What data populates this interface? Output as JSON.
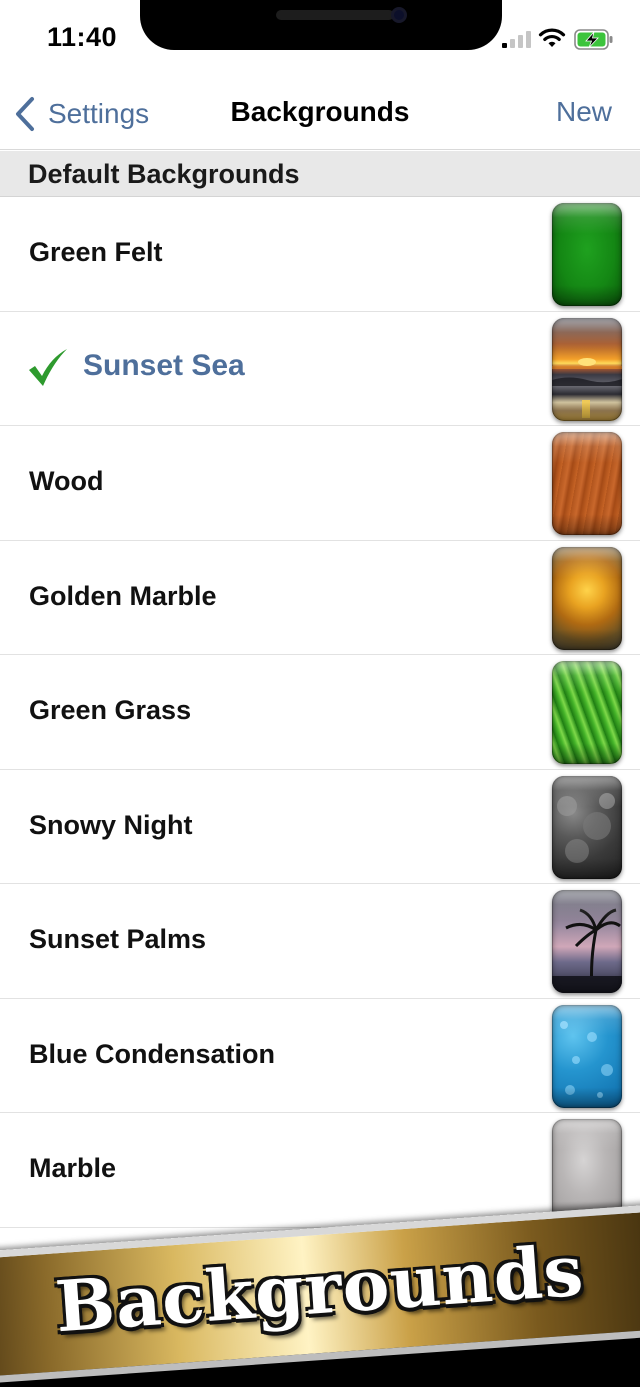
{
  "status_bar": {
    "time": "11:40"
  },
  "nav": {
    "back_label": "Settings",
    "title": "Backgrounds",
    "new_label": "New"
  },
  "section": {
    "title": "Default Backgrounds"
  },
  "backgrounds": [
    {
      "label": "Green Felt",
      "selected": false,
      "thumb": "green-felt-thumbnail"
    },
    {
      "label": "Sunset Sea",
      "selected": true,
      "thumb": "sunset-sea-thumbnail"
    },
    {
      "label": "Wood",
      "selected": false,
      "thumb": "wood-thumbnail"
    },
    {
      "label": "Golden Marble",
      "selected": false,
      "thumb": "golden-marble-thumbnail"
    },
    {
      "label": "Green Grass",
      "selected": false,
      "thumb": "green-grass-thumbnail"
    },
    {
      "label": "Snowy Night",
      "selected": false,
      "thumb": "snowy-night-thumbnail"
    },
    {
      "label": "Sunset Palms",
      "selected": false,
      "thumb": "sunset-palms-thumbnail"
    },
    {
      "label": "Blue Condensation",
      "selected": false,
      "thumb": "blue-condensation-thumbnail"
    },
    {
      "label": "Marble",
      "selected": false,
      "thumb": "marble-thumbnail"
    }
  ],
  "banner": {
    "text": "Backgrounds"
  },
  "colors": {
    "accent": "#4e6f9b",
    "checkmark": "#2e9a2e",
    "section_bg": "#e8e8e8"
  },
  "icons": [
    "chevron-left-icon",
    "checkmark-icon",
    "signal-icon",
    "wifi-icon",
    "battery-charging-icon"
  ]
}
